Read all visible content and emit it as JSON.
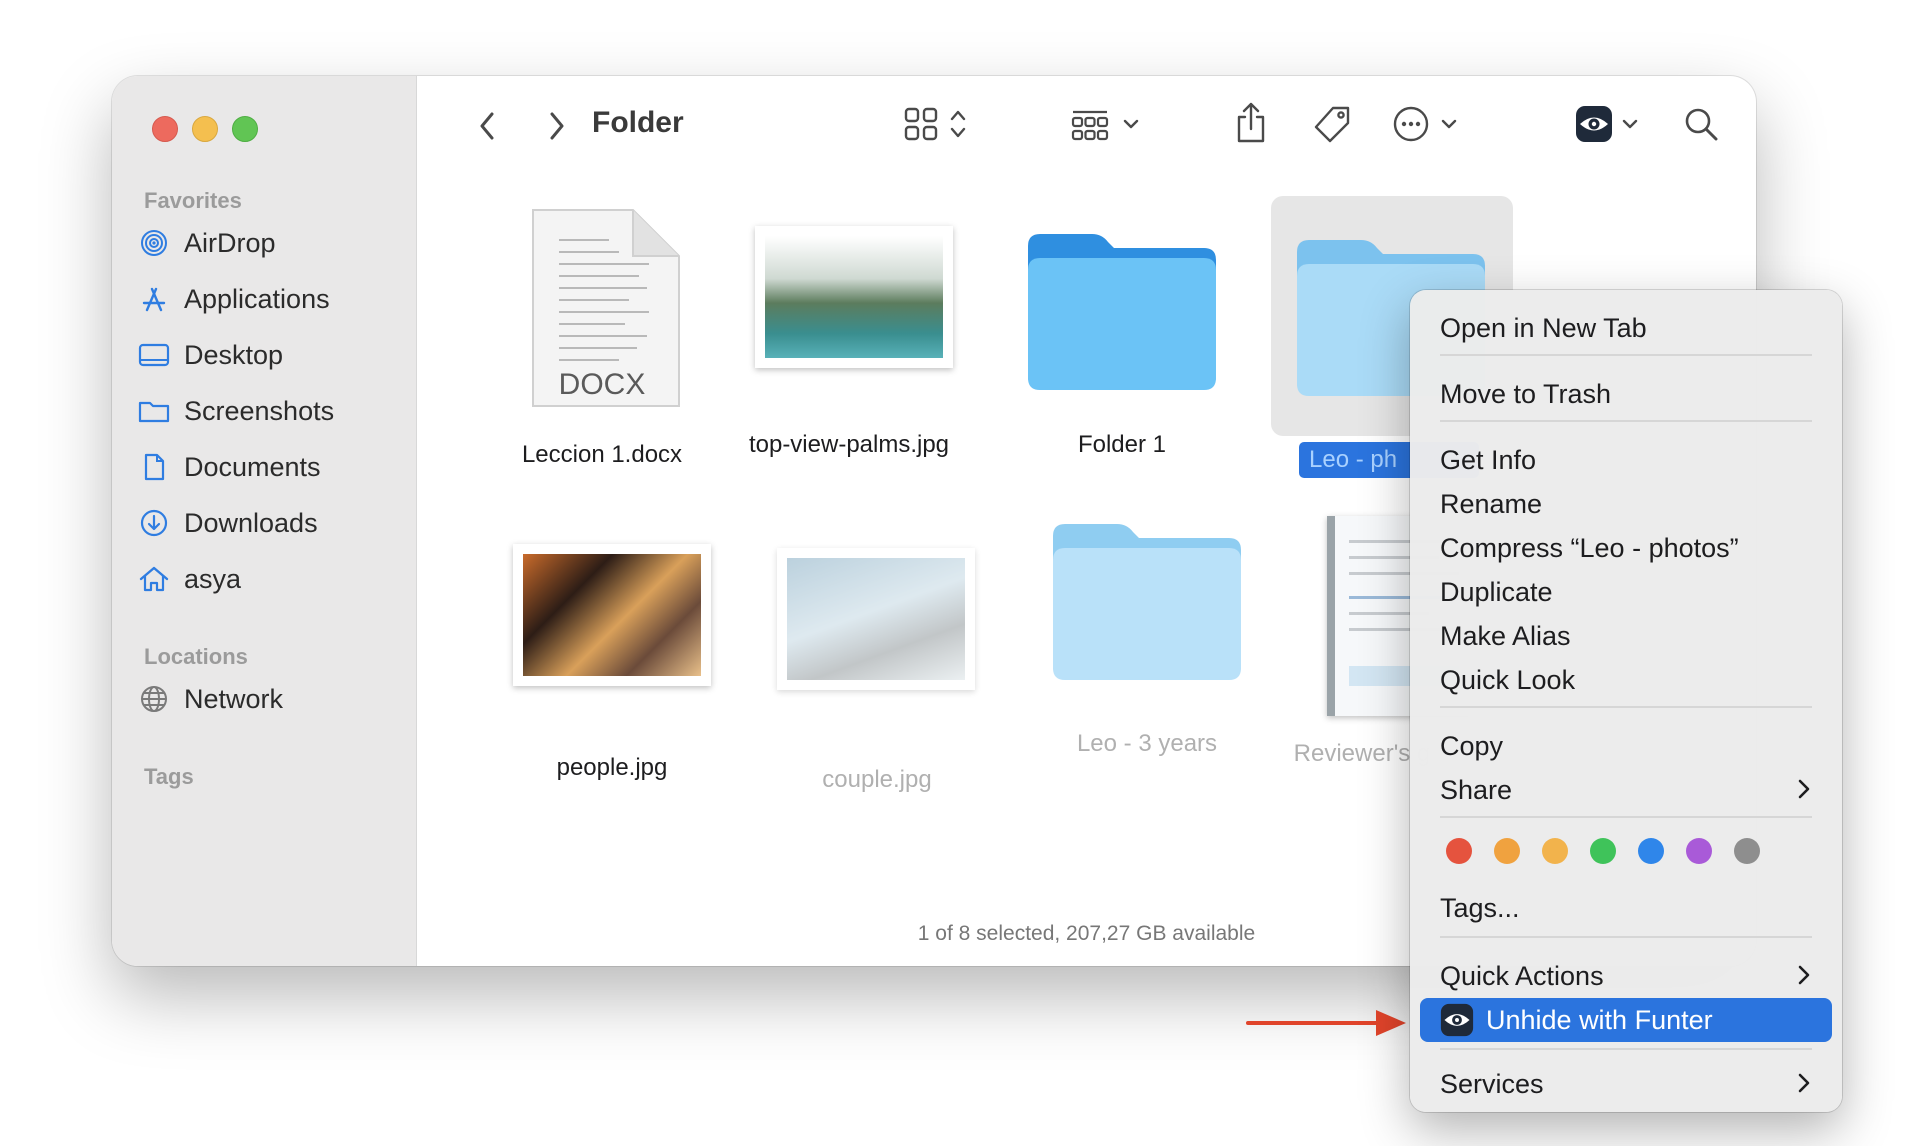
{
  "window": {
    "title": "Folder"
  },
  "sidebar": {
    "favorites_heading": "Favorites",
    "locations_heading": "Locations",
    "tags_heading": "Tags",
    "favorites": [
      {
        "label": "AirDrop",
        "icon": "airdrop-icon"
      },
      {
        "label": "Applications",
        "icon": "applications-icon"
      },
      {
        "label": "Desktop",
        "icon": "desktop-icon"
      },
      {
        "label": "Screenshots",
        "icon": "folder-icon"
      },
      {
        "label": "Documents",
        "icon": "document-icon"
      },
      {
        "label": "Downloads",
        "icon": "downloads-icon"
      },
      {
        "label": "asya",
        "icon": "home-icon"
      }
    ],
    "locations": [
      {
        "label": "Network",
        "icon": "globe-icon"
      }
    ]
  },
  "files": [
    {
      "name": "Leccion 1.docx",
      "kind": "docx",
      "badge": "DOCX",
      "hidden": false
    },
    {
      "name": "top-view-palms.jpg",
      "kind": "image",
      "hidden": false
    },
    {
      "name": "Folder 1",
      "kind": "folder",
      "hidden": false
    },
    {
      "name": "Leo - ph",
      "kind": "folder",
      "hidden": true,
      "selected": true
    },
    {
      "name": "people.jpg",
      "kind": "image",
      "hidden": false
    },
    {
      "name": "couple.jpg",
      "kind": "image",
      "hidden": true
    },
    {
      "name": "Leo - 3 years",
      "kind": "folder",
      "hidden": true
    },
    {
      "name": "Reviewer's g",
      "kind": "document",
      "hidden": true
    }
  ],
  "status_bar": "1 of 8 selected, 207,27 GB available",
  "context_menu": {
    "open_new_tab": "Open in New Tab",
    "move_to_trash": "Move to Trash",
    "get_info": "Get Info",
    "rename": "Rename",
    "compress": "Compress “Leo - photos”",
    "duplicate": "Duplicate",
    "make_alias": "Make Alias",
    "quick_look": "Quick Look",
    "copy": "Copy",
    "share": "Share",
    "tags": "Tags...",
    "quick_actions": "Quick Actions",
    "unhide_funter": "Unhide with Funter",
    "services": "Services",
    "tag_colors": [
      "#e5533e",
      "#f0a23f",
      "#f2b34c",
      "#3fc35a",
      "#2f86ea",
      "#a95ad8",
      "#8e8e8e"
    ]
  },
  "colors": {
    "accent": "#2b74de",
    "arrow": "#e0442b",
    "folder": "#5fb4ee",
    "hidden_folder": "#a6d8f6"
  }
}
